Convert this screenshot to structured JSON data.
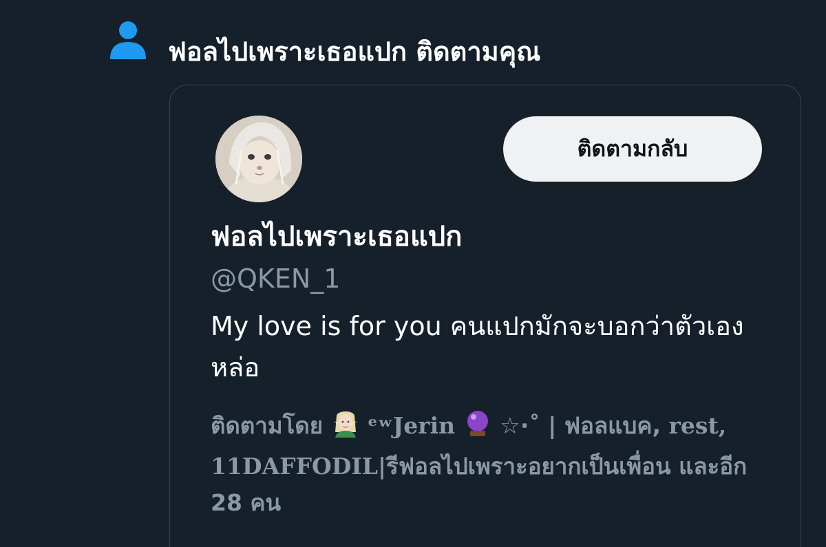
{
  "notification": {
    "icon": "person-icon",
    "text": "ฟอลไปเพราะเธอแปก ติดตามคุณ"
  },
  "card": {
    "follow_back_label": "ติดตามกลับ",
    "display_name": "ฟอลไปเพราะเธอแปก",
    "handle": "@QKEN_1",
    "bio": "My love is for you คนแปกมักจะบอกว่าตัวเองหล่อ",
    "followed_by": {
      "prefix": "ติดตามโดย",
      "follower_name_1": "ᵉʷJerin",
      "follower_name_1_suffix": "☆⋅˚ | ฟอลแบค,",
      "follower_name_2": "rest, 11DAFFODIL|รีฟอลไปเพราะอยากเป็นเพื่อน",
      "others": "และอีก 28 คน"
    }
  },
  "colors": {
    "background": "#15202b",
    "accent": "#1d9bf0",
    "muted_text": "#8b98a5",
    "border": "#38444d",
    "button_bg": "#eff1f2"
  }
}
